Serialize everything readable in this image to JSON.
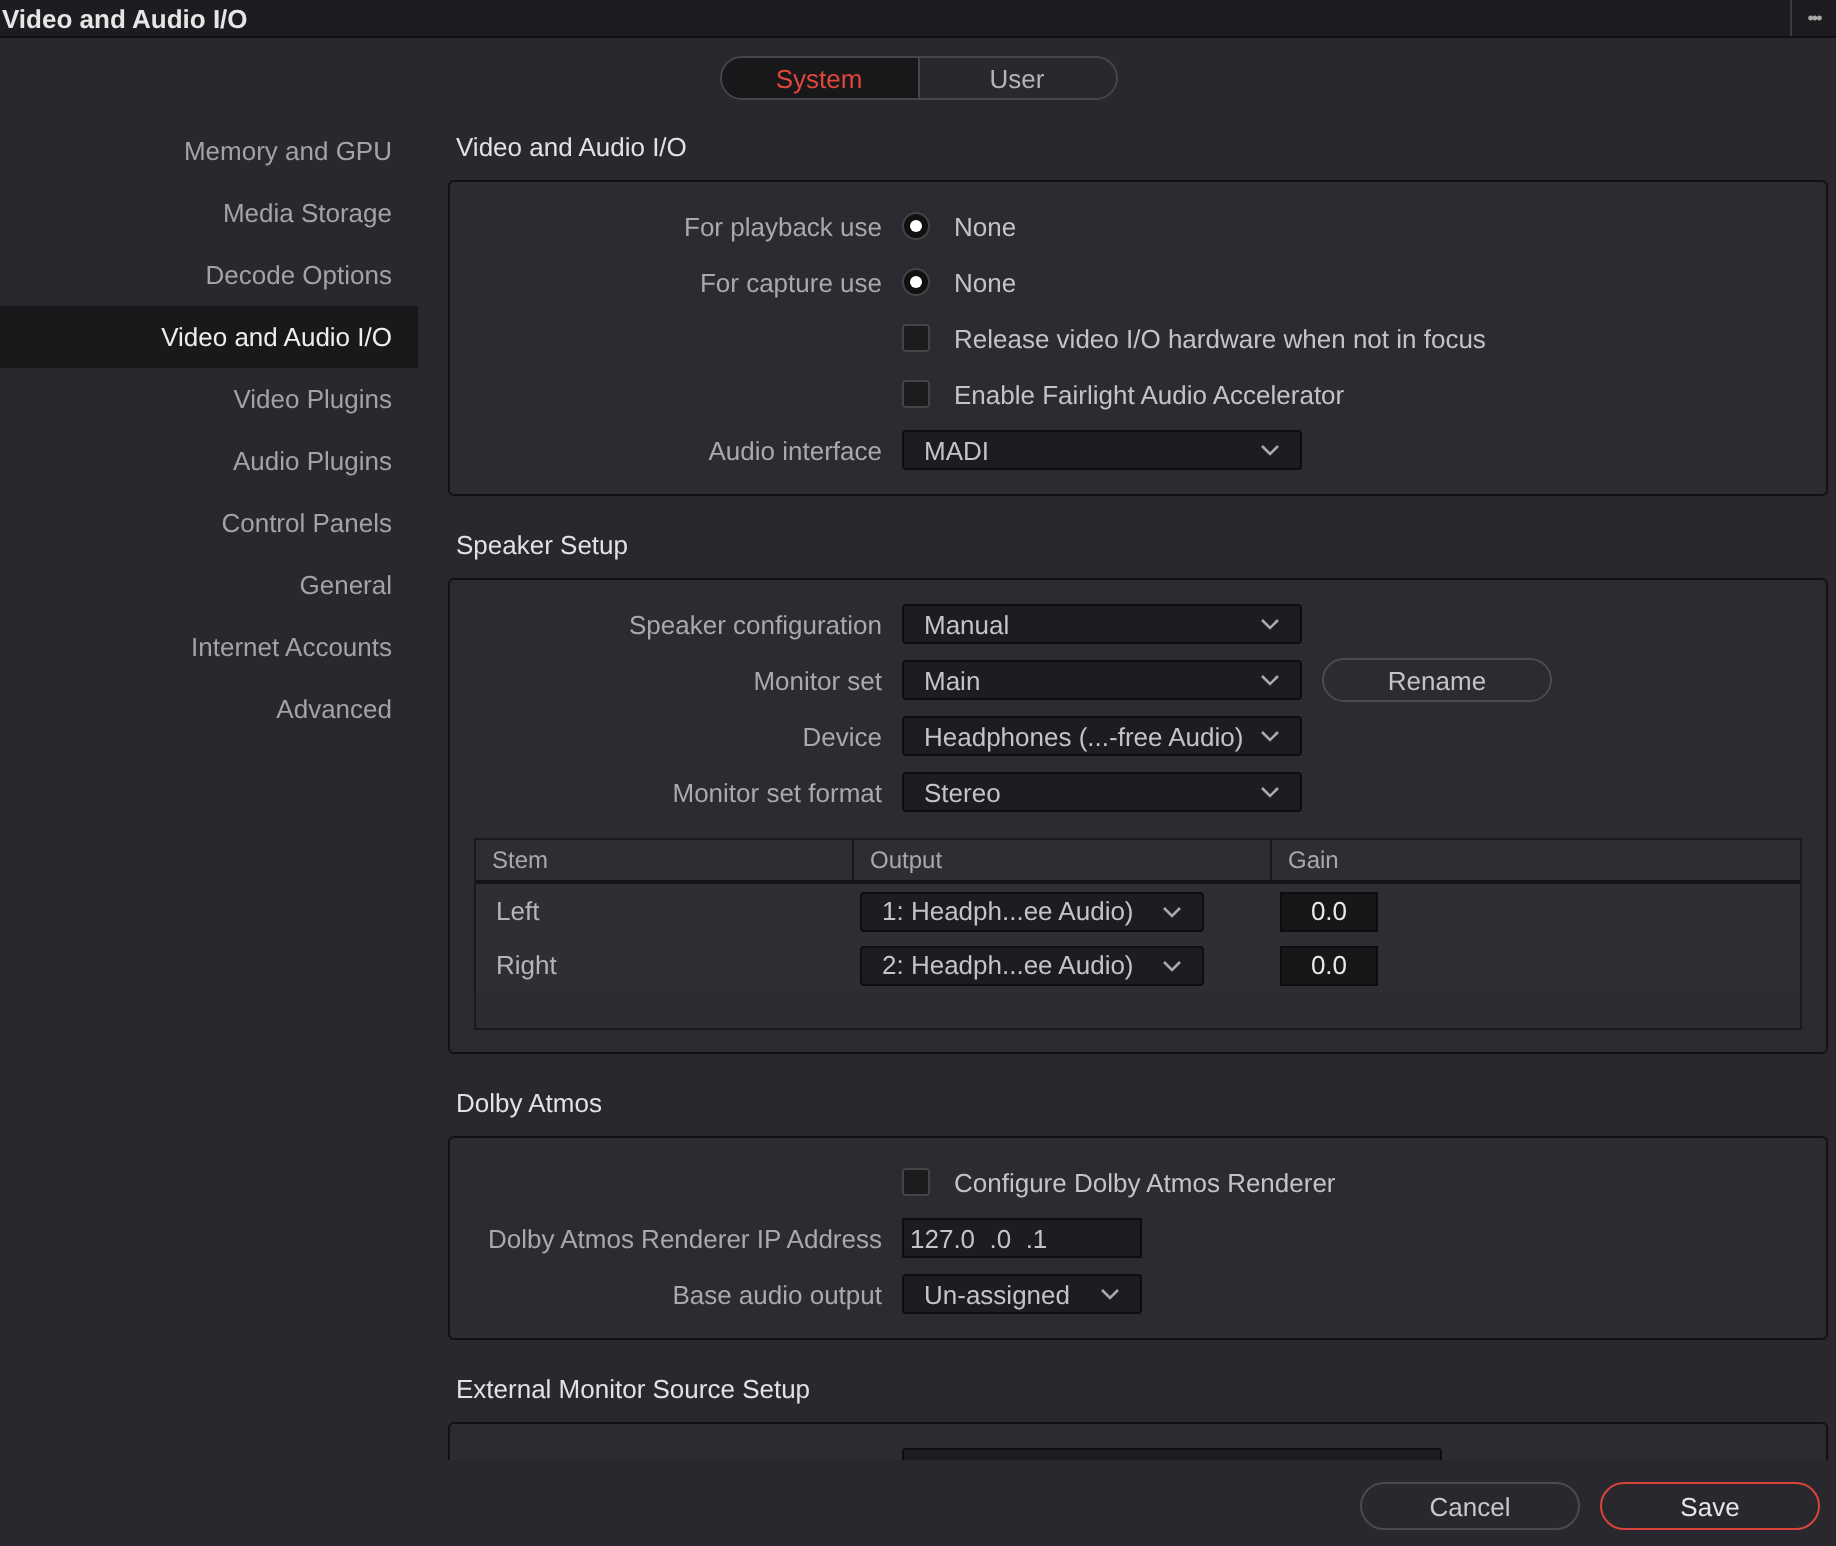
{
  "window": {
    "title": "Video and Audio I/O",
    "menu": "•••"
  },
  "tabs": [
    {
      "label": "System",
      "selected": true
    },
    {
      "label": "User",
      "selected": false
    }
  ],
  "sidebar": {
    "items": [
      {
        "label": "Memory and GPU",
        "selected": false
      },
      {
        "label": "Media Storage",
        "selected": false
      },
      {
        "label": "Decode Options",
        "selected": false
      },
      {
        "label": "Video and Audio I/O",
        "selected": true
      },
      {
        "label": "Video Plugins",
        "selected": false
      },
      {
        "label": "Audio Plugins",
        "selected": false
      },
      {
        "label": "Control Panels",
        "selected": false
      },
      {
        "label": "General",
        "selected": false
      },
      {
        "label": "Internet Accounts",
        "selected": false
      },
      {
        "label": "Advanced",
        "selected": false
      }
    ]
  },
  "sections": [
    {
      "title": "Video and Audio I/O",
      "rows": [
        {
          "kind": "radio",
          "label": "For playback use",
          "value": "None",
          "selected": true
        },
        {
          "kind": "radio",
          "label": "For capture use",
          "value": "None",
          "selected": true
        },
        {
          "kind": "checkbox",
          "text": "Release video I/O hardware when not in focus",
          "checked": false
        },
        {
          "kind": "checkbox",
          "text": "Enable Fairlight Audio Accelerator",
          "checked": false
        },
        {
          "kind": "dropdown",
          "label": "Audio interface",
          "value": "MADI"
        }
      ]
    },
    {
      "title": "Speaker Setup",
      "rows": [
        {
          "kind": "dropdown",
          "label": "Speaker configuration",
          "value": "Manual"
        },
        {
          "kind": "dropdown",
          "label": "Monitor set",
          "value": "Main",
          "button": "Rename"
        },
        {
          "kind": "dropdown",
          "label": "Device",
          "value": "Headphones (...-free Audio)"
        },
        {
          "kind": "dropdown",
          "label": "Monitor set format",
          "value": "Stereo"
        },
        {
          "kind": "table",
          "columns": [
            "Stem",
            "Output",
            "Gain"
          ],
          "rows": [
            {
              "stem": "Left",
              "output": "1: Headph...ee Audio)",
              "gain": "0.0"
            },
            {
              "stem": "Right",
              "output": "2: Headph...ee Audio)",
              "gain": "0.0"
            }
          ]
        }
      ]
    },
    {
      "title": "Dolby Atmos",
      "rows": [
        {
          "kind": "checkbox",
          "text": "Configure Dolby Atmos Renderer",
          "checked": false
        },
        {
          "kind": "input",
          "label": "Dolby Atmos Renderer IP Address",
          "value": "127.0  .0  .1"
        },
        {
          "kind": "dropdown",
          "label": "Base audio output",
          "value": "Un-assigned"
        }
      ]
    },
    {
      "title": "External Monitor Source Setup",
      "rows": [
        {
          "kind": "dropdown"
        }
      ]
    }
  ],
  "footer": {
    "buttons": [
      {
        "label": "Cancel",
        "kind": "secondary"
      },
      {
        "label": "Save",
        "kind": "primary"
      }
    ]
  }
}
